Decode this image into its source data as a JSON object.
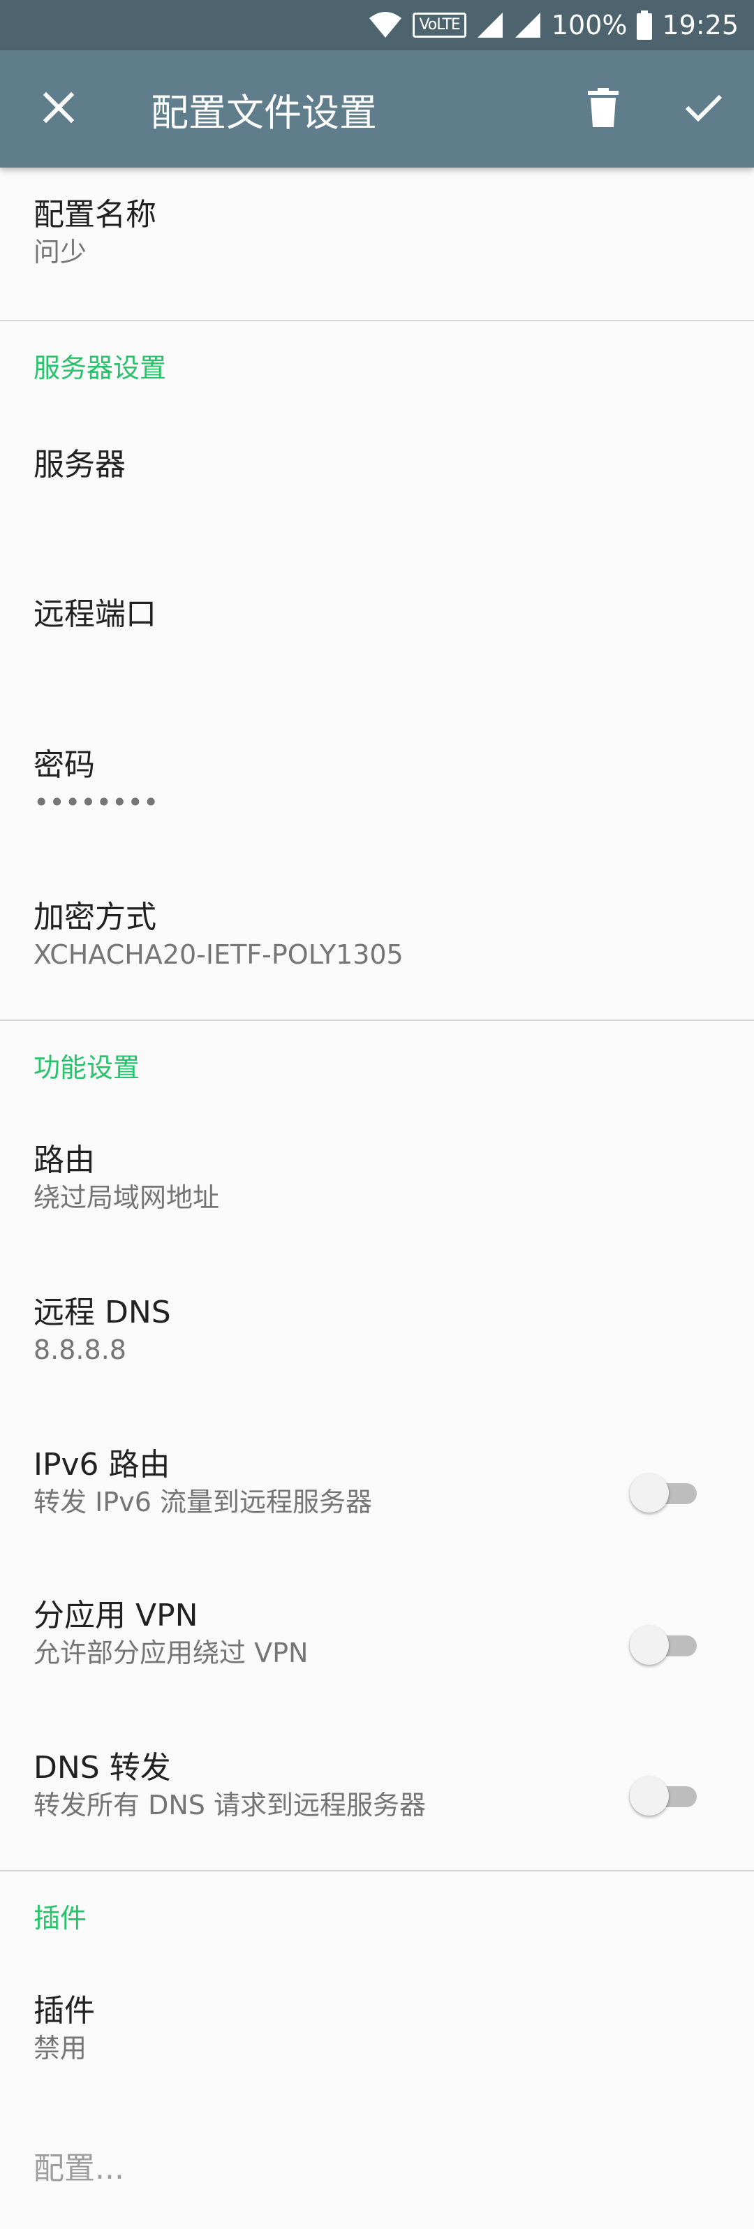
{
  "status_bar": {
    "volte": "VoLTE",
    "battery": "100%",
    "time": "19:25",
    "icons": [
      "wifi-icon",
      "volte-icon",
      "signal-icon",
      "signal-icon",
      "battery-icon"
    ]
  },
  "toolbar": {
    "title": "配置文件设置",
    "close_icon": "close-icon",
    "delete_icon": "delete-icon",
    "done_icon": "check-icon",
    "background": "#607d8b",
    "status_background": "#4d646f"
  },
  "profile": {
    "name_title": "配置名称",
    "name_value": "问少"
  },
  "server_settings": {
    "category": "服务器设置",
    "server_title": "服务器",
    "port_title": "远程端口",
    "password_title": "密码",
    "password_value": "••••••••",
    "method_title": "加密方式",
    "method_value": "XCHACHA20-IETF-POLY1305"
  },
  "feature_settings": {
    "category": "功能设置",
    "route_title": "路由",
    "route_value": "绕过局域网地址",
    "dns_title": "远程 DNS",
    "dns_value": "8.8.8.8",
    "ipv6_title": "IPv6 路由",
    "ipv6_summary": "转发 IPv6 流量到远程服务器",
    "ipv6_enabled": false,
    "per_app_title": "分应用 VPN",
    "per_app_summary": "允许部分应用绕过 VPN",
    "per_app_enabled": false,
    "dns_forward_title": "DNS 转发",
    "dns_forward_summary": "转发所有 DNS 请求到远程服务器",
    "dns_forward_enabled": false
  },
  "plugin_settings": {
    "category": "插件",
    "plugin_title": "插件",
    "plugin_value": "禁用",
    "configure_title": "配置..."
  },
  "accent_color": "#26c46a"
}
